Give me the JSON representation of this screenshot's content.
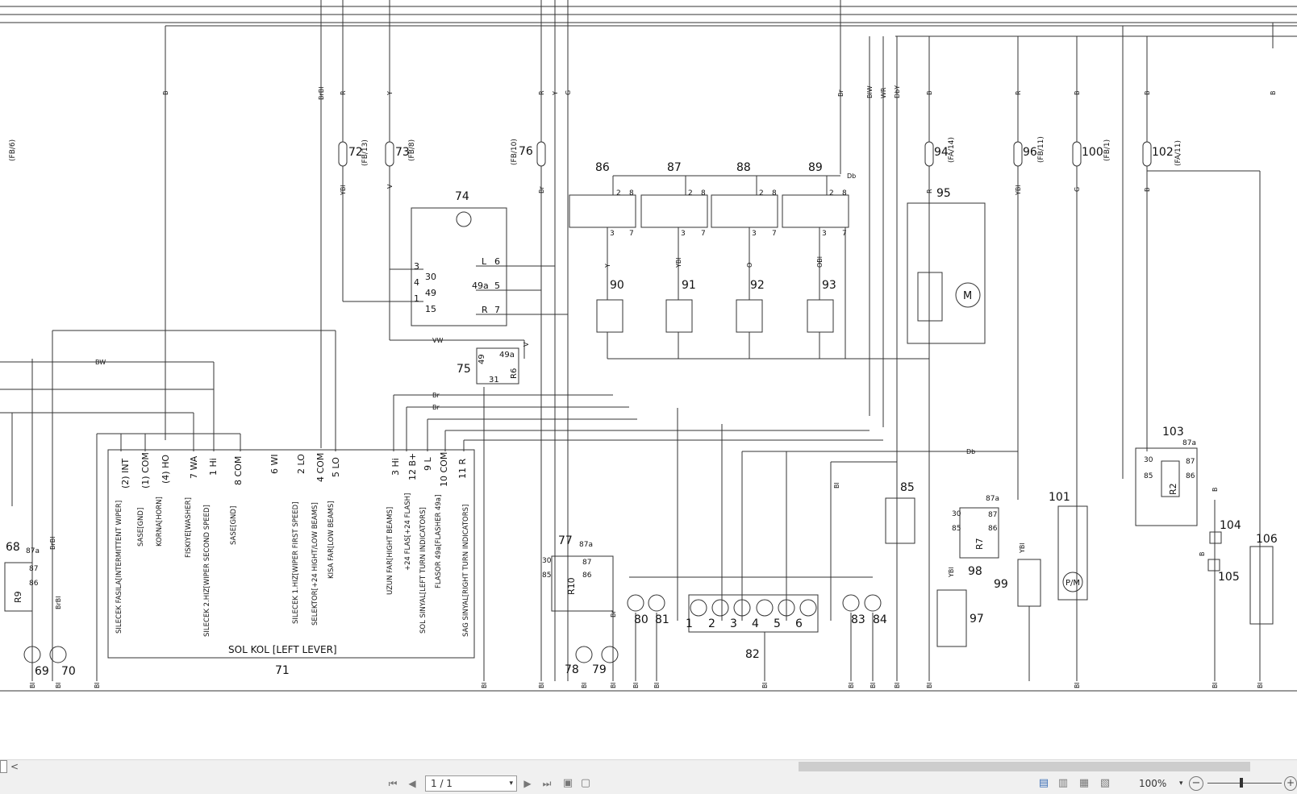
{
  "toolbar": {
    "page_value": "1 / 1",
    "zoom_level": "100%",
    "first_page": "⏮",
    "prev_page": "◀",
    "next_page": "▶",
    "last_page": "⏭",
    "zoom_out": "−",
    "zoom_in": "+",
    "dropdown": "▾"
  },
  "scrollbar": {
    "left_arrow": "<"
  },
  "schematic": {
    "component_numbers": [
      "68",
      "69",
      "70",
      "71",
      "72",
      "73",
      "74",
      "75",
      "76",
      "77",
      "78",
      "79",
      "80",
      "81",
      "82",
      "83",
      "84",
      "85",
      "86",
      "87",
      "88",
      "89",
      "90",
      "91",
      "92",
      "93",
      "94",
      "95",
      "96",
      "97",
      "98",
      "99",
      "100",
      "101",
      "102",
      "103",
      "104",
      "105",
      "106"
    ],
    "fb_refs": {
      "fb6": "(FB/6)",
      "fb13": "(FB/13)",
      "fb8": "(FB/8)",
      "fb10": "(FB/10)",
      "fa14": "(FA/14)",
      "fb11": "(FB/11)",
      "fb1": "(FB/1)",
      "fa11": "(FA/11)"
    },
    "wire_colors": {
      "B": "B",
      "BrBl": "BrBl",
      "R": "R",
      "Y": "Y",
      "G": "G",
      "Br": "Br",
      "BlW": "BlW",
      "WR": "WR",
      "DbY": "DbY",
      "YBl": "YBl",
      "V": "V",
      "O": "O",
      "OBl": "OBl",
      "BW": "BW",
      "VW": "VW",
      "Db": "Db",
      "Bl": "Bl"
    },
    "lever_title": "SOL KOL [LEFT LEVER]",
    "lever_pins": [
      "(2) INT",
      "(1) COM",
      "(4) HO",
      "7 WA",
      "1 Hi",
      "8 COM",
      "6 WI",
      "2 LO",
      "4 COM",
      "5 LO",
      "3 Hi",
      "12 B+",
      "9 L",
      "10 COM",
      "11 R"
    ],
    "lever_functions": [
      "SILECEK FASILA[INTERMITTENT WIPER]",
      "SASE[GND]",
      "KORNA[HORN]",
      "FISKIYE[WASHER]",
      "SILECEK 2.HIZ[WIPER SECOND SPEED]",
      "SASE[GND]",
      "SILECEK 1.HIZ[WIPER FIRST SPEED]",
      "SELEKTOR[+24 HIGHT/LOW BEAMS]",
      "KISA FAR[LOW BEAMS]",
      "UZUN FAR[HIGHT BEAMS]",
      "+24 FLAS[+24 FLASH]",
      "FLASOR 49a[FLASHER 49a]",
      "SOL SINYAL[LEFT TURN INDICATORS]",
      "SAG SINYAL[RIGHT TURN INDICATORS]"
    ],
    "switch74_pins": [
      "3",
      "30",
      "4",
      "49",
      "1",
      "15",
      "L",
      "6",
      "49a",
      "5",
      "R",
      "7"
    ],
    "relay75": {
      "pins": [
        "49a",
        "31",
        "49"
      ],
      "name": "R6"
    },
    "relay_names": {
      "r9": "R9",
      "r10": "R10",
      "r7": "R7",
      "r2": "R2"
    },
    "relay_pins": [
      "87a",
      "87",
      "86",
      "85",
      "30"
    ],
    "indicators82": [
      "1",
      "2",
      "3",
      "4",
      "5",
      "6"
    ],
    "pm_label": "P/M",
    "motor_label": "M",
    "relay_block_pins": [
      "2",
      "8",
      "3",
      "7"
    ]
  }
}
